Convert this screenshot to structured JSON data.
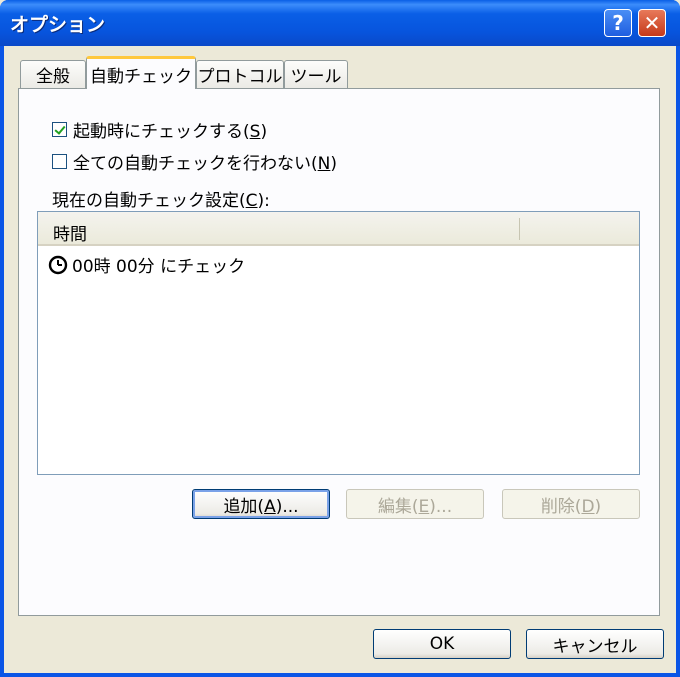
{
  "window": {
    "title": "オプション",
    "help_label": "?",
    "close_label": "✕"
  },
  "tabs": [
    {
      "label": "全般"
    },
    {
      "label": "自動チェック"
    },
    {
      "label": "プロトコル"
    },
    {
      "label": "ツール"
    }
  ],
  "autocheck": {
    "startup_check": {
      "label_main": "起動時にチェックする(",
      "accel": "S",
      "label_end": ")",
      "checked": true
    },
    "disable_all": {
      "label_main": "全ての自動チェックを行わない(",
      "accel": "N",
      "label_end": ")",
      "checked": false
    },
    "current_label_main": "現在の自動チェック設定(",
    "current_accel": "C",
    "current_label_end": "):",
    "list": {
      "column_header": "時間",
      "rows": [
        {
          "icon": "clock-icon",
          "text": "00時 00分 にチェック"
        }
      ]
    },
    "buttons": {
      "add": {
        "main": "追加(",
        "accel": "A",
        "end": ")..."
      },
      "edit": {
        "main": "編集(",
        "accel": "E",
        "end": ")..."
      },
      "delete": {
        "main": "削除(",
        "accel": "D",
        "end": ")"
      }
    }
  },
  "footer": {
    "ok_label": "OK",
    "cancel_label": "キャンセル"
  }
}
